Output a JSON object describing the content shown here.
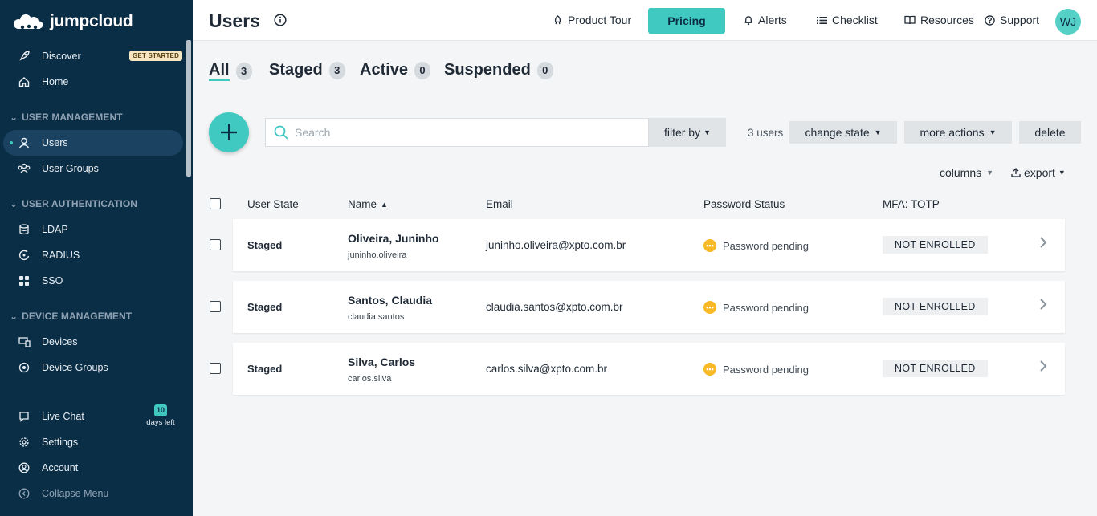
{
  "app": {
    "brand": "jumpcloud",
    "accent": "#40c9c0",
    "sidebar_bg": "#0b2e47"
  },
  "sidebar": {
    "top_items": [
      {
        "label": "Discover",
        "icon": "rocket-icon",
        "badge": "GET STARTED"
      },
      {
        "label": "Home",
        "icon": "home-icon"
      }
    ],
    "sections": [
      {
        "title": "USER MANAGEMENT",
        "items": [
          {
            "label": "Users",
            "icon": "user-icon",
            "active": true
          },
          {
            "label": "User Groups",
            "icon": "user-groups-icon"
          }
        ]
      },
      {
        "title": "USER AUTHENTICATION",
        "items": [
          {
            "label": "LDAP",
            "icon": "database-icon"
          },
          {
            "label": "RADIUS",
            "icon": "radius-icon"
          },
          {
            "label": "SSO",
            "icon": "grid-icon"
          }
        ]
      },
      {
        "title": "DEVICE MANAGEMENT",
        "items": [
          {
            "label": "Devices",
            "icon": "devices-icon"
          },
          {
            "label": "Device Groups",
            "icon": "device-groups-icon"
          }
        ]
      }
    ],
    "bottom_items": [
      {
        "label": "Live Chat",
        "icon": "chat-icon"
      },
      {
        "label": "Settings",
        "icon": "gear-icon"
      },
      {
        "label": "Account",
        "icon": "account-icon"
      },
      {
        "label": "Collapse Menu",
        "icon": "collapse-icon"
      }
    ],
    "trial": {
      "days": "10",
      "label": "days left"
    }
  },
  "topbar": {
    "title": "Users",
    "product_tour": "Product Tour",
    "pricing": "Pricing",
    "alerts": "Alerts",
    "checklist": "Checklist",
    "resources": "Resources",
    "support": "Support",
    "avatar": "WJ"
  },
  "tabs": [
    {
      "label": "All",
      "count": "3",
      "active": true
    },
    {
      "label": "Staged",
      "count": "3"
    },
    {
      "label": "Active",
      "count": "0"
    },
    {
      "label": "Suspended",
      "count": "0"
    }
  ],
  "toolbar": {
    "search_placeholder": "Search",
    "filter_by": "filter by",
    "user_count": "3 users",
    "change_state": "change state",
    "more_actions": "more actions",
    "delete": "delete",
    "columns": "columns",
    "export": "export"
  },
  "table": {
    "headers": {
      "state": "User State",
      "name": "Name",
      "email": "Email",
      "password": "Password Status",
      "mfa": "MFA: TOTP"
    },
    "rows": [
      {
        "state": "Staged",
        "name": "Oliveira, Juninho",
        "username": "juninho.oliveira",
        "email": "juninho.oliveira@xpto.com.br",
        "password": "Password pending",
        "mfa": "NOT ENROLLED"
      },
      {
        "state": "Staged",
        "name": "Santos, Claudia",
        "username": "claudia.santos",
        "email": "claudia.santos@xpto.com.br",
        "password": "Password pending",
        "mfa": "NOT ENROLLED"
      },
      {
        "state": "Staged",
        "name": "Silva, Carlos",
        "username": "carlos.silva",
        "email": "carlos.silva@xpto.com.br",
        "password": "Password pending",
        "mfa": "NOT ENROLLED"
      }
    ]
  }
}
